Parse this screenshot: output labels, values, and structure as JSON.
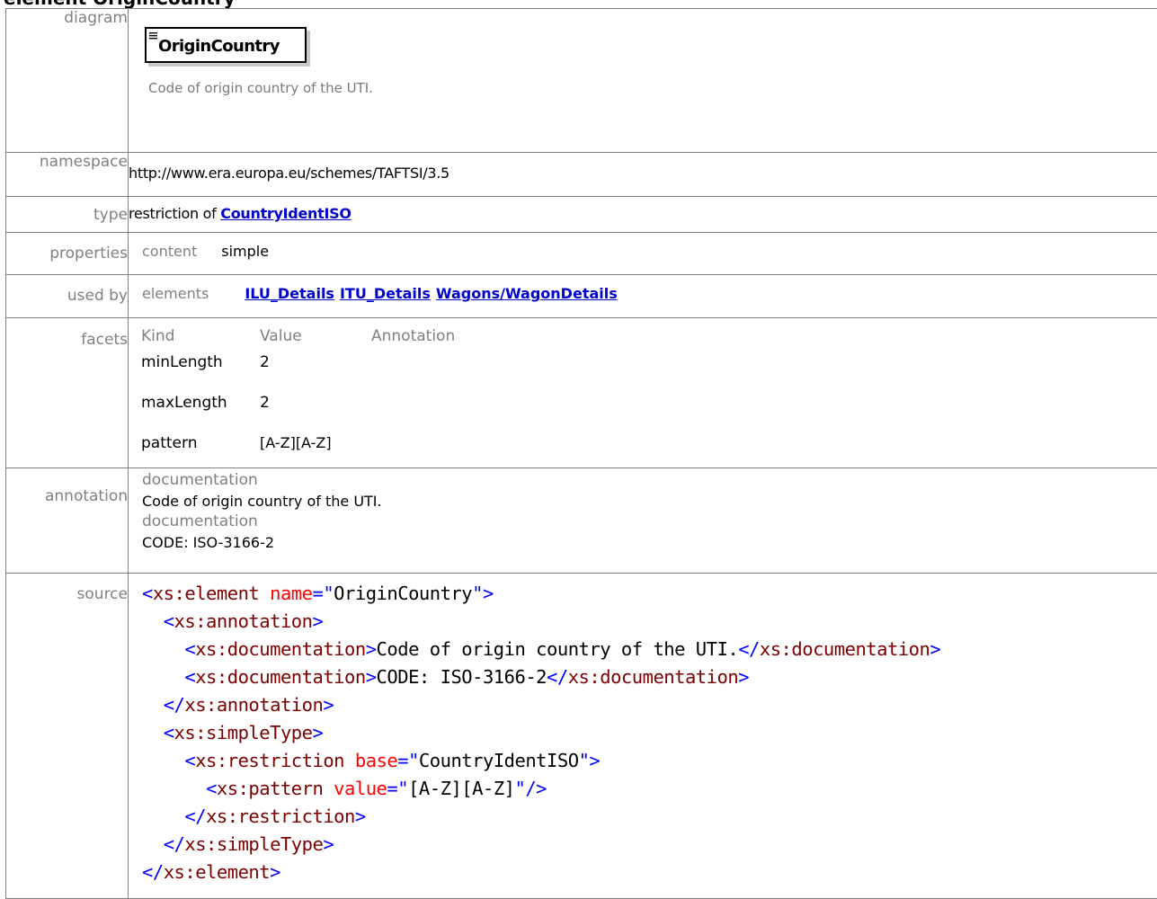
{
  "header": {
    "title": "element OriginCountry"
  },
  "labels": {
    "diagram": "diagram",
    "namespace": "namespace",
    "type": "type",
    "properties": "properties",
    "used_by": "used by",
    "facets": "facets",
    "annotation": "annotation",
    "source": "source"
  },
  "diagram": {
    "element_name": "OriginCountry",
    "description": "Code of origin country of the UTI.",
    "icon": "element-content-icon"
  },
  "namespace": "http://www.era.europa.eu/schemes/TAFTSI/3.5",
  "type": {
    "prefix": "restriction of",
    "link": "CountryIdentISO"
  },
  "properties": {
    "key": "content",
    "value": "simple"
  },
  "used_by": {
    "key": "elements",
    "links": [
      "ILU_Details",
      "ITU_Details",
      "Wagons/WagonDetails"
    ]
  },
  "facets": {
    "headers": [
      "Kind",
      "Value",
      "Annotation"
    ],
    "rows": [
      {
        "kind": "minLength",
        "value": "2",
        "annotation": ""
      },
      {
        "kind": "maxLength",
        "value": "2",
        "annotation": ""
      },
      {
        "kind": "pattern",
        "value": "[A-Z][A-Z]",
        "annotation": ""
      }
    ]
  },
  "annotation": {
    "items": [
      {
        "label": "documentation",
        "text": "Code of origin country of the UTI."
      },
      {
        "label": "documentation",
        "text": "CODE: ISO-3166-2"
      }
    ]
  },
  "source": {
    "element_tag": "xs:element",
    "name_attr": "name",
    "name_value": "OriginCountry",
    "annotation_tag": "xs:annotation",
    "documentation_tag": "xs:documentation",
    "doc1": "Code of origin country of the UTI.",
    "doc2": "CODE: ISO-3166-2",
    "simpletype_tag": "xs:simpleType",
    "restriction_tag": "xs:restriction",
    "base_attr": "base",
    "base_value": "CountryIdentISO",
    "pattern_tag": "xs:pattern",
    "value_attr": "value",
    "pattern_value": "[A-Z][A-Z]"
  }
}
